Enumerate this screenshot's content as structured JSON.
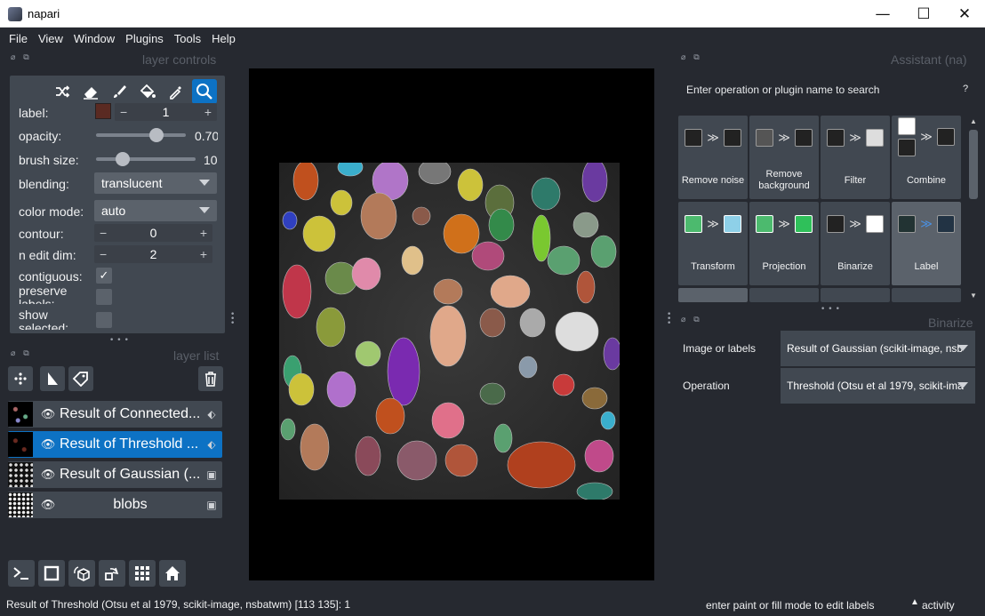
{
  "window": {
    "title": "napari",
    "minimize": "—",
    "maximize": "☐",
    "close": "✕"
  },
  "menu": [
    "File",
    "View",
    "Window",
    "Plugins",
    "Tools",
    "Help"
  ],
  "layer_controls": {
    "header": "layer controls",
    "tools": [
      "shuffle-icon",
      "eraser-icon",
      "paint-brush-icon",
      "fill-bucket-icon",
      "color-picker-icon",
      "zoom-icon"
    ],
    "label": {
      "name": "label:",
      "value": "1",
      "color": "#5a2a22"
    },
    "opacity": {
      "name": "opacity:",
      "value": "0.70",
      "level": 0.7
    },
    "brush_size": {
      "name": "brush size:",
      "value": "10",
      "level": 0.3
    },
    "blending": {
      "name": "blending:",
      "value": "translucent"
    },
    "color_mode": {
      "name": "color mode:",
      "value": "auto"
    },
    "contour": {
      "name": "contour:",
      "value": "0"
    },
    "n_edit_dim": {
      "name": "n edit dim:",
      "value": "2"
    },
    "contiguous": {
      "name": "contiguous:",
      "checked": true
    },
    "preserve_labels": {
      "name": "preserve labels:",
      "checked": false
    },
    "show_selected": {
      "name": "show selected:",
      "checked": false
    }
  },
  "layer_list": {
    "header": "layer list",
    "layers": [
      {
        "name": "Result of Connected...",
        "type": "label-icon",
        "selected": false
      },
      {
        "name": "Result of Threshold ...",
        "type": "label-icon",
        "selected": true
      },
      {
        "name": "Result of Gaussian (...",
        "type": "image-icon",
        "selected": false
      },
      {
        "name": "blobs",
        "type": "image-icon",
        "selected": false
      }
    ]
  },
  "assistant": {
    "header": "Assistant (na)",
    "search_placeholder": "Enter operation or plugin name to search",
    "help": "?",
    "tiles": [
      {
        "label": "Remove noise"
      },
      {
        "label": "Remove background"
      },
      {
        "label": "Filter"
      },
      {
        "label": "Combine"
      },
      {
        "label": "Transform"
      },
      {
        "label": "Projection"
      },
      {
        "label": "Binarize"
      },
      {
        "label": "Label"
      }
    ]
  },
  "binarize": {
    "header": "Binarize",
    "image_label": "Image or labels",
    "image_value": "Result of Gaussian (scikit-image, nsb",
    "operation_label": "Operation",
    "operation_value": "Threshold (Otsu et al 1979, scikit-ima"
  },
  "status": {
    "left": "Result of Threshold (Otsu et al 1979, scikit-image, nsbatwm) [113 135]: 1",
    "hint": "enter paint or fill mode to edit labels",
    "activity": "activity"
  },
  "colors": {
    "accent": "#0d72c4",
    "panel": "#414851",
    "background": "#262930"
  }
}
